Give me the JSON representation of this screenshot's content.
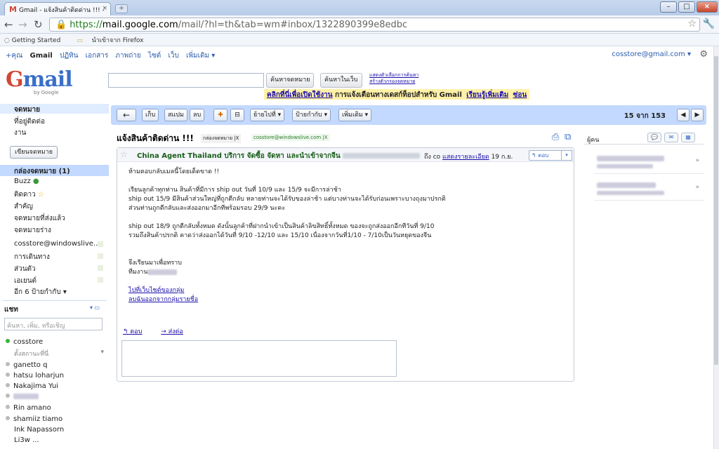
{
  "browser": {
    "tab_title": "Gmail - แจ้งสินค้าติดด่าน !!! - ",
    "tab_close": "×",
    "url_https": "https://",
    "url_domain": "mail.google.com",
    "url_rest": "/mail/?hl=th&tab=wm#inbox/1322890399e8edbc",
    "bookmarks": [
      "Getting Started",
      "นำเข้าจาก Firefox"
    ]
  },
  "gbar": {
    "items": [
      "+คุณ",
      "Gmail",
      "ปฏิทิน",
      "เอกสาร",
      "ภาพถ่าย",
      "ไซต์",
      "เว็บ",
      "เพิ่มเติม ▾"
    ],
    "account": "cosstore@gmail.com ▾"
  },
  "logo": {
    "g": "G",
    "mail": "mail",
    "sub": "by Google"
  },
  "search": {
    "search_mail": "ค้นหาจดหมาย",
    "search_web": "ค้นหาในเว็บ",
    "options": "แสดงตัวเลือกการค้นหา",
    "create_filter": "สร้างตัวกรองจดหมาย"
  },
  "notice": {
    "click": "คลิกที่นี่เพื่อเปิดใช้งาน",
    "text": " การแจ้งเตือนทางเดสก์ท็อปสำหรับ Gmail",
    "learn": "เรียนรู้เพิ่มเติม",
    "hide": "ซ่อน"
  },
  "leftnav": {
    "top": [
      "จดหมาย",
      "ที่อยู่ติดต่อ",
      "งาน"
    ],
    "compose": "เขียนจดหมาย",
    "inbox": "กล่องจดหมาย (1)",
    "items": [
      "Buzz",
      "ติดดาว",
      "สำคัญ",
      "จดหมายที่ส่งแล้ว",
      "จดหมายร่าง"
    ],
    "labels": [
      "cosstore@windowslive....",
      "การเดินทาง",
      "ส่วนตัว",
      "เอเยนต์"
    ],
    "more": "อีก 6 ป้ายกำกับ ▾"
  },
  "chat": {
    "header": "แชท",
    "search_placeholder": "ค้นหา, เพิ่ม, หรือเชิญ",
    "me": "cosstore",
    "status": "ตั้งสถานะที่นี่",
    "contacts": [
      "ganetto q",
      "hatsu loharjun",
      "Nakajima Yui",
      "",
      "Rin amano",
      "shamiiz tiamo",
      "Ink Napassorn",
      "Li3w ..."
    ]
  },
  "toolbar": {
    "back": "←",
    "archive": "เก็บ",
    "spam": "สแปม",
    "delete": "ลบ",
    "move": "ย้ายไปที่ ▾",
    "labels": "ป้ายกำกับ ▾",
    "more": "เพิ่มเติม ▾",
    "page": "15 จาก 153"
  },
  "message": {
    "subject": "แจ้งสินค้าติดด่าน !!!",
    "tag1": "กล่องจดหมาย",
    "tag2": "cosstore@windowslive.com",
    "from": "China Agent Thailand บริการ จัดซื้อ จัดหา และนำเข้าจากจีน",
    "to": "ถึง co",
    "details": "แสดงรายละเอียด",
    "date": "19 ก.ย.",
    "reply": "ตอบ",
    "body": [
      "ห้ามตอบกลับเมลนี้โดยเด็ดขาด !!",
      "เรียนลูกค้าทุกท่าน สินค้าที่มีการ ship out วันที่ 10/9 และ 15/9 จะมีการล่าช้า",
      "ship out 15/9 มีสินค้าส่วนใหญ่ที่ถูกตีกลับ หลายท่านจะได้รับของล่าช้า แต่บางท่านจะได้รับก่อนเพราะบางถุงมาปรกติ",
      "ส่วนท่านถูกตีกลับและส่งออกมาอีกทีพร้อมรอบ 29/9 นะคะ",
      "ship out 18/9 ถูกตีกลับทั้งหมด ดังนั้นลูกค้าที่ฝากนำเข้าเป็นสินค้าลิขสิทธิ์ทั้งหมด ของจะถูกส่งออกอีกทีวันที่ 9/10",
      "รวมถึงสินค้าปรกติ คาดว่าส่งออกได้วันที่ 9/10 -12/10 และ 15/10 เนื่องจากวันที่1/10 - 7/10เป็นวันหยุดของจีน",
      "จึงเรียนมาเพื่อทราบ",
      "ทีมงาน",
      "ไปที่เว็บไซต์ของกลุ่ม",
      "ลบฉันออกจากกลุ่มรายชื่อ"
    ],
    "reply_link": "ตอบ",
    "forward_link": "ส่งต่อ"
  },
  "people": {
    "header": "ผู้คน"
  }
}
